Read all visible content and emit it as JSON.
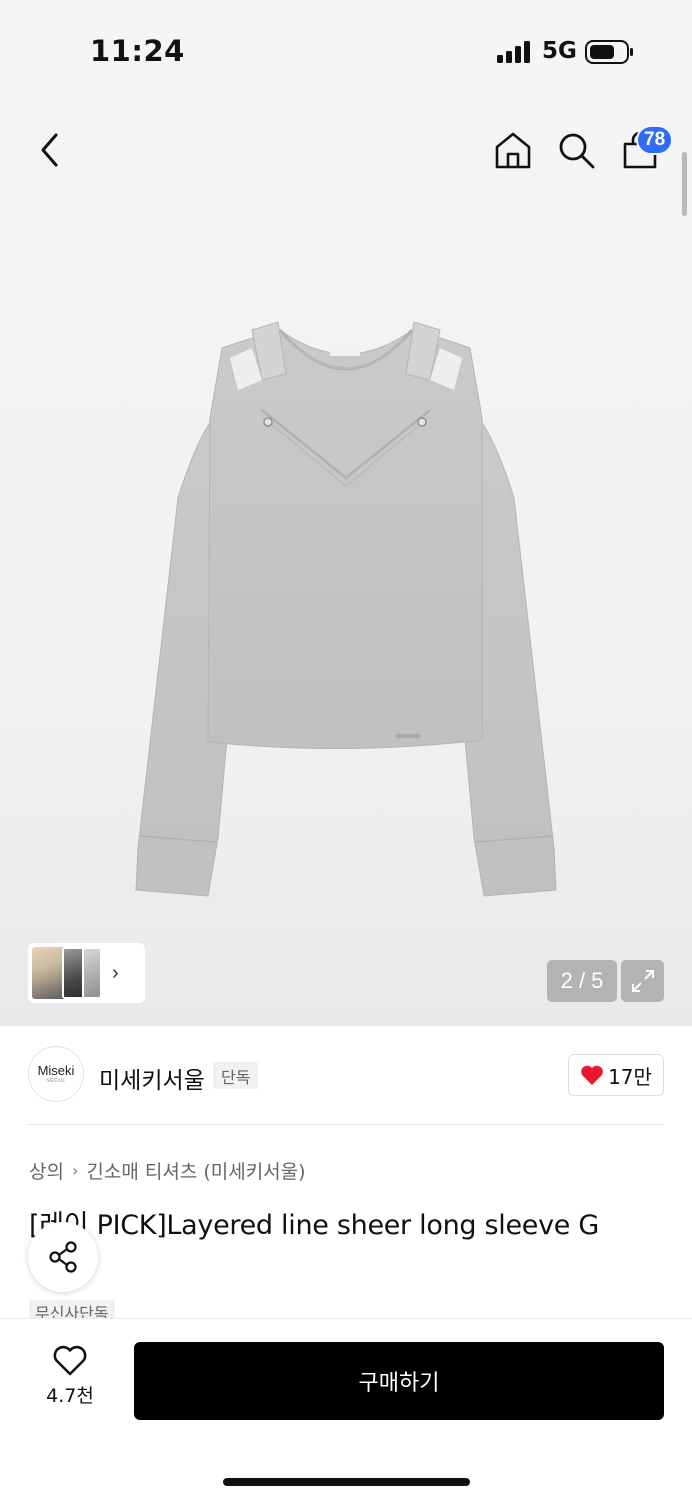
{
  "status_bar": {
    "time": "11:24",
    "network": "5G"
  },
  "header": {
    "cart_count": "78"
  },
  "gallery": {
    "page_counter": "2 / 5"
  },
  "brand": {
    "logo_text": "Miseki",
    "logo_subtext": "SEOUL",
    "name": "미세키서울",
    "exclusive_tag": "단독",
    "like_count": "17만"
  },
  "product": {
    "breadcrumb": [
      "상의",
      "긴소매 티셔츠 (미세키서울)"
    ],
    "title": "[레이 PICK]Layered line sheer long sleeve G",
    "tag": "무신사단독"
  },
  "bottom_bar": {
    "wish_count": "4.7천",
    "buy_label": "구매하기"
  },
  "colors": {
    "badge": "#2f6df6",
    "heart": "#e8192c",
    "buy_button": "#000000"
  }
}
